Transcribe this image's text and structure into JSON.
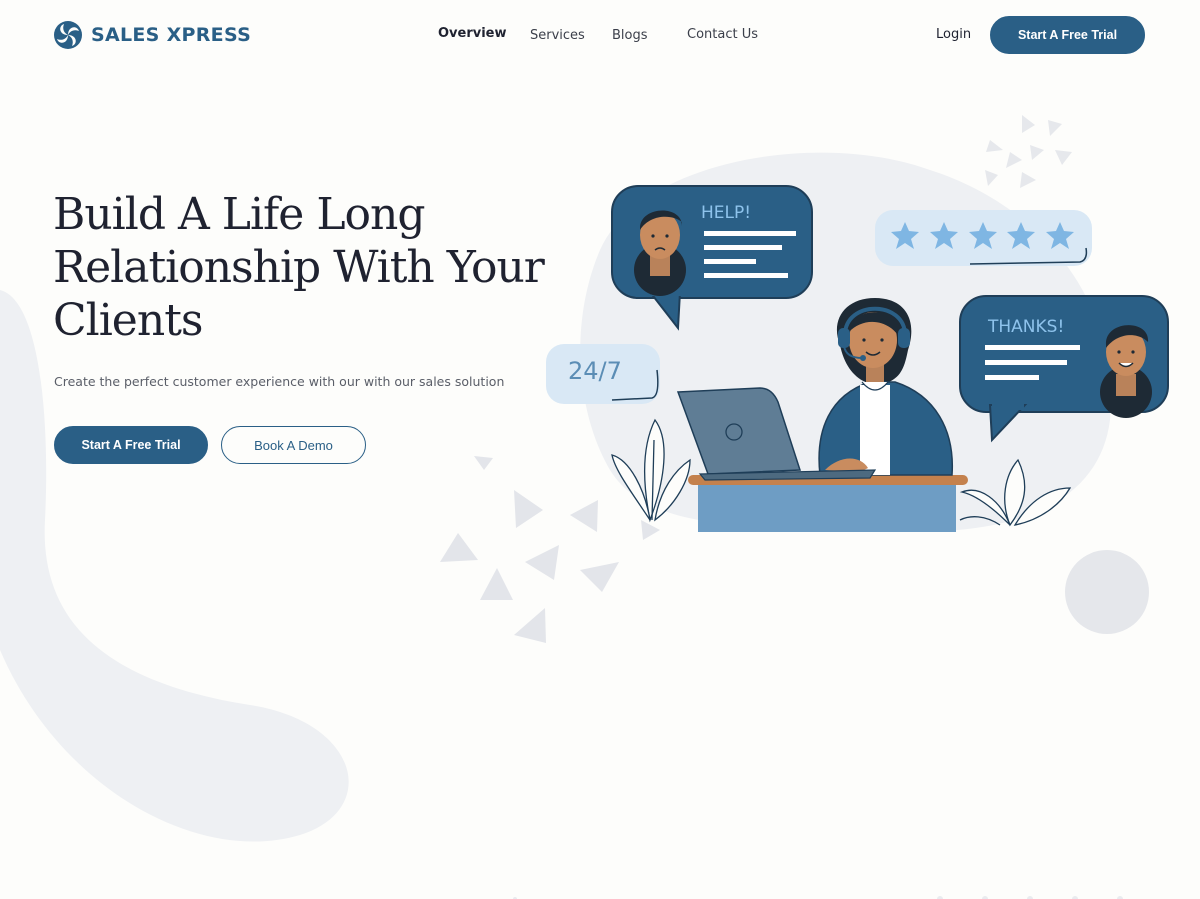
{
  "brand": {
    "name": "SALES XPRESS"
  },
  "nav": {
    "links": [
      {
        "label": "Overview",
        "active": true
      },
      {
        "label": "Services",
        "active": false
      },
      {
        "label": "Blogs",
        "active": false
      },
      {
        "label": "Contact Us",
        "active": false
      }
    ],
    "login_label": "Login",
    "cta_label": "Start A Free Trial"
  },
  "hero": {
    "title": "Build A Life Long Relationship With Your Clients",
    "subtitle": "Create the perfect customer experience with our with our sales solution",
    "primary_cta": "Start A Free Trial",
    "secondary_cta": "Book A Demo"
  },
  "illustration": {
    "help_bubble": "HELP!",
    "thanks_bubble": "THANKS!",
    "availability_bubble": "24/7",
    "rating_stars": 5
  },
  "colors": {
    "brand": "#2a5f86",
    "accent_light": "#d9e8f5",
    "star": "#7fb6e3",
    "background": "#fdfdfb"
  }
}
